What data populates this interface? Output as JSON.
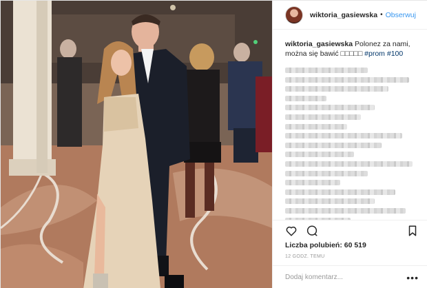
{
  "post": {
    "username": "wiktoria_gasiewska",
    "separator": "•",
    "follow_label": "Obserwuj",
    "caption_user": "wiktoria_gasiewska",
    "caption_text": "Polonez za nami, można się bawić □□□□□",
    "hashtag_1": "#prom",
    "hashtag_2": "#100",
    "likes": "Liczba polubień: 60 519",
    "time": "12 GODZ. TEMU",
    "comment_placeholder": "Dodaj komentarz...",
    "more_label": "•••"
  },
  "icons": {
    "like": "heart-icon",
    "comment": "comment-icon",
    "save": "bookmark-icon",
    "more": "more-options-icon"
  },
  "colors": {
    "link_blue": "#3897f0",
    "hashtag": "#003569",
    "muted": "#999999",
    "text": "#262626",
    "border": "#efefef"
  }
}
